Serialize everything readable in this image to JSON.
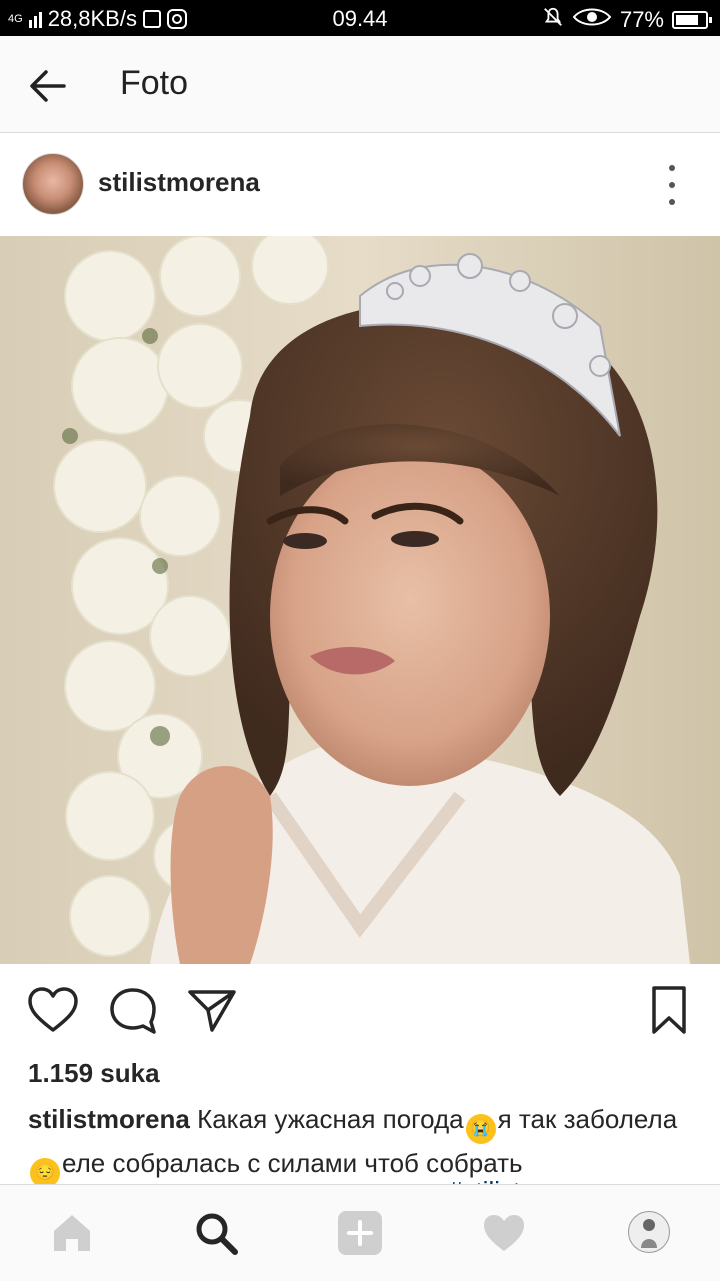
{
  "status_bar": {
    "network": "4G",
    "speed": "28,8KB/s",
    "time": "09.44",
    "battery": "77%",
    "battery_level": 0.77
  },
  "app_bar": {
    "title": "Foto"
  },
  "post": {
    "username": "stilistmorena",
    "likes": "1.159 suka",
    "caption_user": "stilistmorena",
    "caption_part1": "Какая ужасная погода",
    "emoji1": "😭",
    "caption_part2": "я так заболела",
    "emoji2": "😔",
    "caption_part3": "еле собралась с силами чтоб собрать",
    "caption_hidden_hashtag": "#stilist"
  },
  "icons": {
    "back": "arrow-left-icon",
    "more": "more-vertical-icon",
    "like": "heart-icon",
    "comment": "comment-icon",
    "share": "send-icon",
    "save": "bookmark-icon",
    "home": "home-icon",
    "search": "search-icon",
    "add": "add-icon",
    "activity": "heart-icon",
    "profile": "profile-icon"
  },
  "colors": {
    "accent": "#262626",
    "link": "#003569",
    "nav_inactive": "#cfcfcf"
  }
}
